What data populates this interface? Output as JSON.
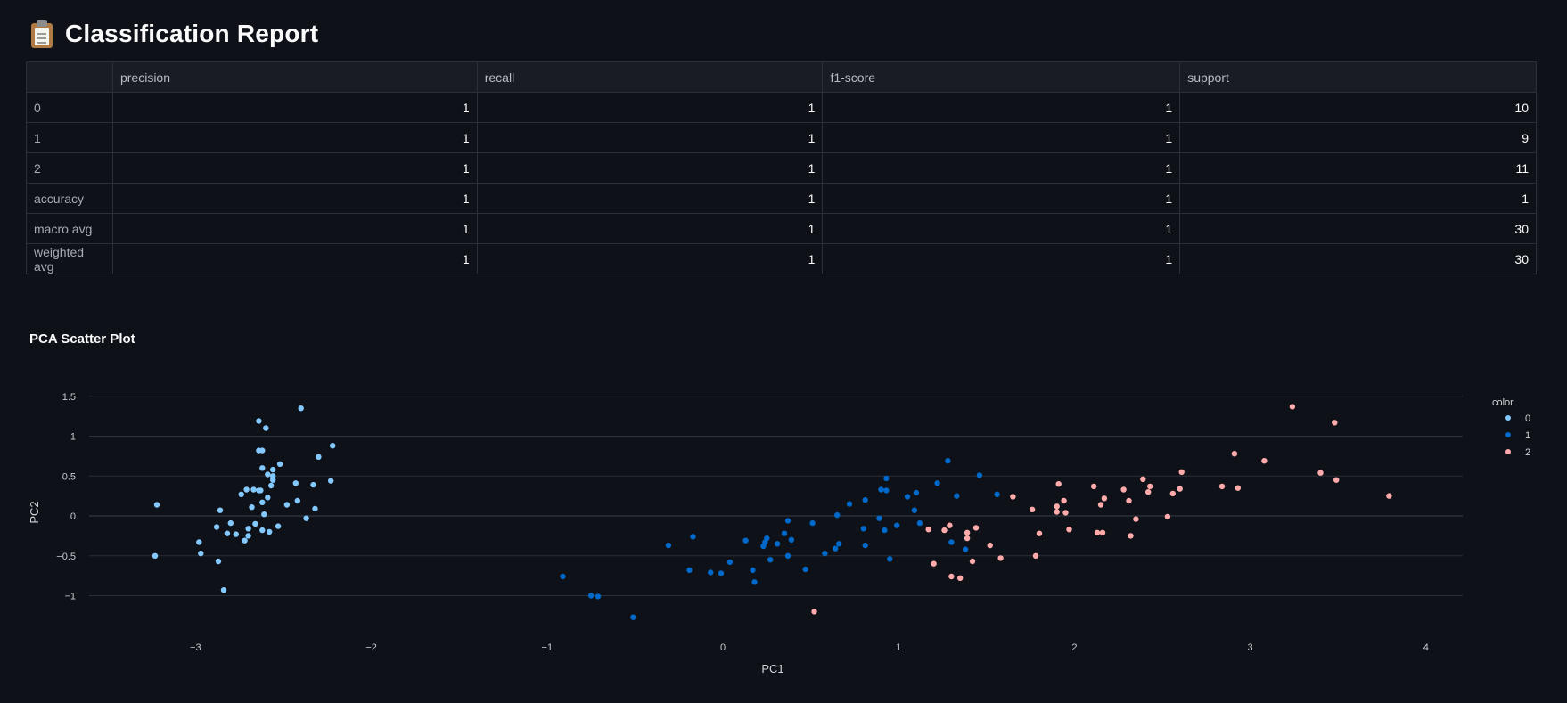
{
  "page": {
    "title": "Classification Report"
  },
  "report_table": {
    "columns": [
      "",
      "precision",
      "recall",
      "f1-score",
      "support"
    ],
    "rows": [
      {
        "label": "0",
        "values": [
          "1",
          "1",
          "1",
          "10"
        ]
      },
      {
        "label": "1",
        "values": [
          "1",
          "1",
          "1",
          "9"
        ]
      },
      {
        "label": "2",
        "values": [
          "1",
          "1",
          "1",
          "11"
        ]
      },
      {
        "label": "accuracy",
        "values": [
          "1",
          "1",
          "1",
          "1"
        ]
      },
      {
        "label": "macro avg",
        "values": [
          "1",
          "1",
          "1",
          "30"
        ]
      },
      {
        "label": "weighted avg",
        "values": [
          "1",
          "1",
          "1",
          "30"
        ]
      }
    ]
  },
  "section": {
    "title": "PCA Scatter Plot"
  },
  "chart_data": {
    "type": "scatter",
    "xlabel": "PC1",
    "ylabel": "PC2",
    "xlim": [
      -3.7,
      4.2
    ],
    "ylim": [
      -1.35,
      1.6
    ],
    "xticks": [
      -3,
      -2,
      -1,
      0,
      1,
      2,
      3,
      4
    ],
    "yticks": [
      1.5,
      1,
      0.5,
      0,
      -0.5,
      -1
    ],
    "xtick_labels": [
      "−3",
      "−2",
      "−1",
      "0",
      "1",
      "2",
      "3",
      "4"
    ],
    "ytick_labels": [
      "1.5",
      "1",
      "0.5",
      "0",
      "−0.5",
      "−1"
    ],
    "grid": true,
    "legend": {
      "title": "color",
      "position": "top-right"
    },
    "series": [
      {
        "name": "0",
        "color": "#83c9ff",
        "points": [
          [
            -3.22,
            0.14
          ],
          [
            -3.23,
            -0.5
          ],
          [
            -2.98,
            -0.33
          ],
          [
            -2.97,
            -0.47
          ],
          [
            -2.88,
            -0.14
          ],
          [
            -2.87,
            -0.57
          ],
          [
            -2.86,
            0.07
          ],
          [
            -2.84,
            -0.93
          ],
          [
            -2.82,
            -0.22
          ],
          [
            -2.8,
            -0.09
          ],
          [
            -2.77,
            -0.23
          ],
          [
            -2.74,
            0.27
          ],
          [
            -2.72,
            -0.31
          ],
          [
            -2.71,
            0.33
          ],
          [
            -2.7,
            -0.16
          ],
          [
            -2.7,
            -0.25
          ],
          [
            -2.68,
            0.11
          ],
          [
            -2.67,
            0.33
          ],
          [
            -2.66,
            -0.1
          ],
          [
            -2.64,
            0.32
          ],
          [
            -2.64,
            0.82
          ],
          [
            -2.64,
            1.19
          ],
          [
            -2.63,
            0.32
          ],
          [
            -2.62,
            0.82
          ],
          [
            -2.62,
            0.6
          ],
          [
            -2.62,
            0.17
          ],
          [
            -2.62,
            -0.18
          ],
          [
            -2.61,
            0.02
          ],
          [
            -2.6,
            1.1
          ],
          [
            -2.59,
            0.52
          ],
          [
            -2.59,
            0.23
          ],
          [
            -2.58,
            -0.2
          ],
          [
            -2.57,
            0.38
          ],
          [
            -2.56,
            0.45
          ],
          [
            -2.56,
            0.5
          ],
          [
            -2.56,
            0.58
          ],
          [
            -2.53,
            -0.13
          ],
          [
            -2.52,
            0.65
          ],
          [
            -2.48,
            0.14
          ],
          [
            -2.43,
            0.41
          ],
          [
            -2.42,
            0.19
          ],
          [
            -2.4,
            1.35
          ],
          [
            -2.37,
            -0.03
          ],
          [
            -2.33,
            0.39
          ],
          [
            -2.32,
            0.09
          ],
          [
            -2.3,
            0.74
          ],
          [
            -2.23,
            0.44
          ],
          [
            -2.22,
            0.88
          ]
        ]
      },
      {
        "name": "1",
        "color": "#0068c9",
        "points": [
          [
            -0.91,
            -0.76
          ],
          [
            -0.75,
            -1.0
          ],
          [
            -0.71,
            -1.01
          ],
          [
            -0.51,
            -1.27
          ],
          [
            -0.31,
            -0.37
          ],
          [
            -0.19,
            -0.68
          ],
          [
            -0.17,
            -0.26
          ],
          [
            -0.07,
            -0.71
          ],
          [
            -0.01,
            -0.72
          ],
          [
            0.04,
            -0.58
          ],
          [
            0.13,
            -0.31
          ],
          [
            0.17,
            -0.68
          ],
          [
            0.18,
            -0.83
          ],
          [
            0.23,
            -0.38
          ],
          [
            0.24,
            -0.33
          ],
          [
            0.25,
            -0.28
          ],
          [
            0.27,
            -0.55
          ],
          [
            0.31,
            -0.35
          ],
          [
            0.35,
            -0.22
          ],
          [
            0.37,
            -0.5
          ],
          [
            0.37,
            -0.06
          ],
          [
            0.39,
            -0.3
          ],
          [
            0.47,
            -0.67
          ],
          [
            0.51,
            -0.09
          ],
          [
            0.58,
            -0.47
          ],
          [
            0.64,
            -0.41
          ],
          [
            0.65,
            0.01
          ],
          [
            0.66,
            -0.35
          ],
          [
            0.72,
            0.15
          ],
          [
            0.8,
            -0.16
          ],
          [
            0.81,
            0.2
          ],
          [
            0.81,
            -0.37
          ],
          [
            0.89,
            -0.03
          ],
          [
            0.9,
            0.33
          ],
          [
            0.92,
            -0.18
          ],
          [
            0.93,
            0.47
          ],
          [
            0.93,
            0.32
          ],
          [
            0.95,
            -0.54
          ],
          [
            0.99,
            -0.12
          ],
          [
            1.05,
            0.24
          ],
          [
            1.09,
            0.07
          ],
          [
            1.1,
            0.29
          ],
          [
            1.12,
            -0.09
          ],
          [
            1.22,
            0.41
          ],
          [
            1.28,
            0.69
          ],
          [
            1.3,
            -0.33
          ],
          [
            1.33,
            0.25
          ],
          [
            1.38,
            -0.42
          ],
          [
            1.46,
            0.51
          ],
          [
            1.56,
            0.27
          ]
        ]
      },
      {
        "name": "2",
        "color": "#ffabab",
        "points": [
          [
            0.52,
            -1.2
          ],
          [
            1.17,
            -0.17
          ],
          [
            1.2,
            -0.6
          ],
          [
            1.26,
            -0.18
          ],
          [
            1.29,
            -0.12
          ],
          [
            1.3,
            -0.76
          ],
          [
            1.35,
            -0.78
          ],
          [
            1.39,
            -0.21
          ],
          [
            1.39,
            -0.28
          ],
          [
            1.42,
            -0.57
          ],
          [
            1.44,
            -0.15
          ],
          [
            1.52,
            -0.37
          ],
          [
            1.58,
            -0.53
          ],
          [
            1.65,
            0.24
          ],
          [
            1.76,
            0.08
          ],
          [
            1.78,
            -0.5
          ],
          [
            1.8,
            -0.22
          ],
          [
            1.9,
            0.05
          ],
          [
            1.9,
            0.12
          ],
          [
            1.91,
            0.4
          ],
          [
            1.94,
            0.19
          ],
          [
            1.95,
            0.04
          ],
          [
            1.97,
            -0.17
          ],
          [
            2.11,
            0.37
          ],
          [
            2.13,
            -0.21
          ],
          [
            2.15,
            0.14
          ],
          [
            2.16,
            -0.21
          ],
          [
            2.17,
            0.22
          ],
          [
            2.28,
            0.33
          ],
          [
            2.31,
            0.19
          ],
          [
            2.32,
            -0.25
          ],
          [
            2.35,
            -0.04
          ],
          [
            2.39,
            0.46
          ],
          [
            2.42,
            0.3
          ],
          [
            2.43,
            0.37
          ],
          [
            2.53,
            -0.01
          ],
          [
            2.56,
            0.28
          ],
          [
            2.6,
            0.34
          ],
          [
            2.61,
            0.55
          ],
          [
            2.84,
            0.37
          ],
          [
            2.91,
            0.78
          ],
          [
            2.93,
            0.35
          ],
          [
            3.08,
            0.69
          ],
          [
            3.24,
            1.37
          ],
          [
            3.4,
            0.54
          ],
          [
            3.48,
            1.17
          ],
          [
            3.49,
            0.45
          ],
          [
            3.79,
            0.25
          ]
        ]
      }
    ]
  }
}
